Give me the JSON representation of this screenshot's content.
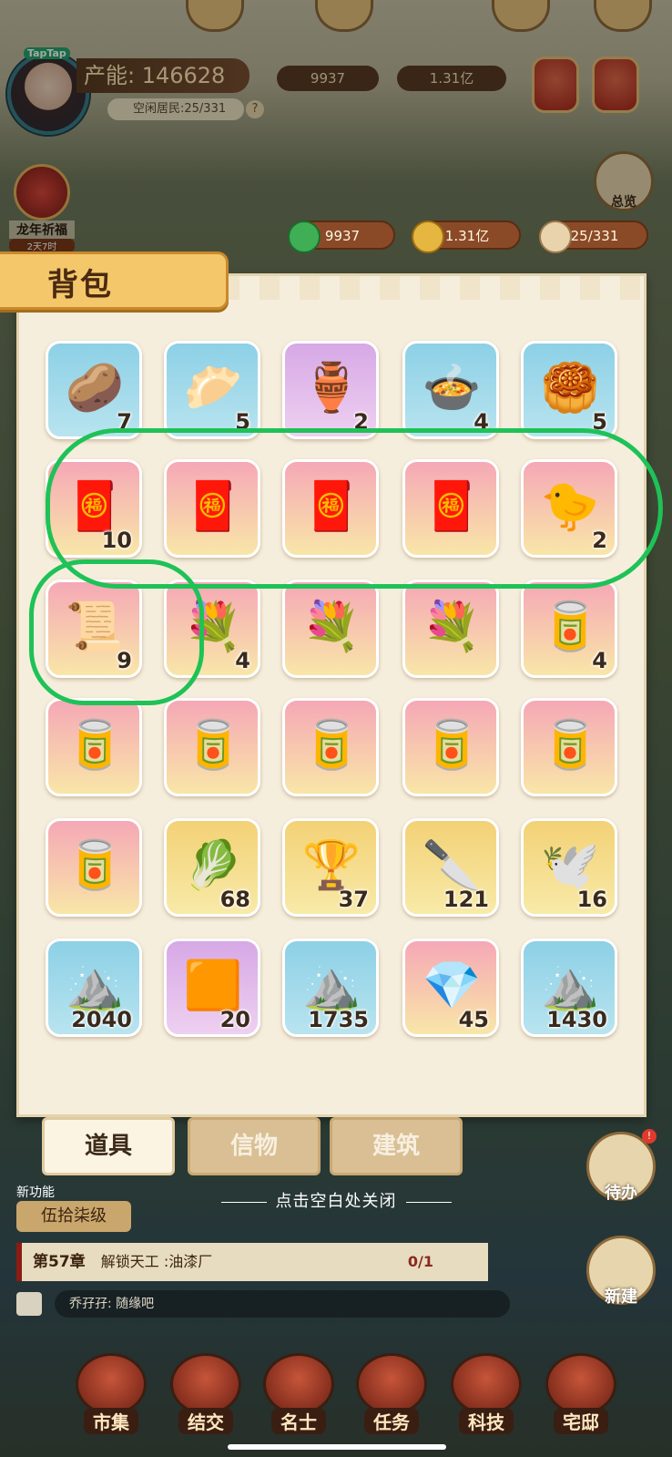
{
  "hud": {
    "power": "产能: 146628",
    "idle_residents": "空闲居民:25/331",
    "help": "?",
    "top_currency_1": "9937",
    "top_currency_2": "1.31亿",
    "overview_label": "总览",
    "festival_title": "龙年祈福",
    "festival_countdown": "2天7时",
    "taptap": "TapTap"
  },
  "resources": [
    {
      "icon": "jade-coin-icon",
      "value": "9937"
    },
    {
      "icon": "gold-coin-icon",
      "value": "1.31亿"
    },
    {
      "icon": "residents-icon",
      "value": "25/331"
    }
  ],
  "panel": {
    "title": "背包"
  },
  "items": [
    {
      "icon": "🥔",
      "name": "ginger-root",
      "bg": "blue",
      "count": "7"
    },
    {
      "icon": "🥟",
      "name": "steamed-buns",
      "bg": "blue",
      "count": "5"
    },
    {
      "icon": "🏺",
      "name": "plum-vase",
      "bg": "purple",
      "count": "2"
    },
    {
      "icon": "🍲",
      "name": "rice-bowl",
      "bg": "blue",
      "count": "4"
    },
    {
      "icon": "🥮",
      "name": "steamer-basket",
      "bg": "blue",
      "count": "5"
    },
    {
      "icon": "🧧",
      "name": "red-envelope",
      "bg": "pink",
      "count": "10"
    },
    {
      "icon": "🧧",
      "name": "red-envelope",
      "bg": "pink",
      "count": ""
    },
    {
      "icon": "🧧",
      "name": "red-envelope",
      "bg": "pink",
      "count": ""
    },
    {
      "icon": "🧧",
      "name": "red-envelope",
      "bg": "pink",
      "count": ""
    },
    {
      "icon": "🐤",
      "name": "rubber-duck",
      "bg": "pink",
      "count": "2"
    },
    {
      "icon": "📜",
      "name": "paper-scroll",
      "bg": "pink",
      "count": "9"
    },
    {
      "icon": "💐",
      "name": "flower-vase",
      "bg": "pink",
      "count": "4"
    },
    {
      "icon": "💐",
      "name": "flower-vase",
      "bg": "pink",
      "count": ""
    },
    {
      "icon": "💐",
      "name": "flower-vase",
      "bg": "pink",
      "count": ""
    },
    {
      "icon": "🥫",
      "name": "fish-can",
      "bg": "pink",
      "count": "4"
    },
    {
      "icon": "🥫",
      "name": "fish-can",
      "bg": "pink",
      "count": ""
    },
    {
      "icon": "🥫",
      "name": "fish-can",
      "bg": "pink",
      "count": ""
    },
    {
      "icon": "🥫",
      "name": "fish-can",
      "bg": "pink",
      "count": ""
    },
    {
      "icon": "🥫",
      "name": "fish-can",
      "bg": "pink",
      "count": ""
    },
    {
      "icon": "🥫",
      "name": "fish-can",
      "bg": "pink",
      "count": ""
    },
    {
      "icon": "🥫",
      "name": "fish-can",
      "bg": "pink",
      "count": ""
    },
    {
      "icon": "🥬",
      "name": "turnip",
      "bg": "yellow",
      "count": "68"
    },
    {
      "icon": "🏆",
      "name": "palace-cup",
      "bg": "yellow",
      "count": "37"
    },
    {
      "icon": "🔪",
      "name": "razor-blade",
      "bg": "yellow",
      "count": "121"
    },
    {
      "icon": "🕊️",
      "name": "wreath-dove",
      "bg": "yellow",
      "count": "16"
    },
    {
      "icon": "⛰️",
      "name": "gold-sand",
      "bg": "blue",
      "count": "2040"
    },
    {
      "icon": "🟧",
      "name": "amber-ore",
      "bg": "purple",
      "count": "20"
    },
    {
      "icon": "⛰️",
      "name": "pink-sand",
      "bg": "blue",
      "count": "1735"
    },
    {
      "icon": "💎",
      "name": "ruby-ore",
      "bg": "pink",
      "count": "45"
    },
    {
      "icon": "⛰️",
      "name": "gray-sand",
      "bg": "blue",
      "count": "1430"
    }
  ],
  "tabs": [
    {
      "label": "道具",
      "active": true
    },
    {
      "label": "信物",
      "active": false
    },
    {
      "label": "建筑",
      "active": false
    }
  ],
  "close_hint": "点击空白处关闭",
  "lower": {
    "new_feature": "新功能",
    "level": "伍拾柒级",
    "chapter": "第57章",
    "chapter_task": "解锁天工 :油漆厂",
    "chapter_progress": "0/1",
    "chat_text": "乔孖孖: 随缘吧",
    "todo_label": "待办",
    "todo_badge": "!",
    "build_label": "新建"
  },
  "nav": [
    {
      "label": "市集",
      "icon": "market-icon"
    },
    {
      "label": "结交",
      "icon": "cards-icon"
    },
    {
      "label": "名士",
      "icon": "scholar-icon"
    },
    {
      "label": "任务",
      "icon": "task-icon"
    },
    {
      "label": "科技",
      "icon": "tech-icon"
    },
    {
      "label": "宅邸",
      "icon": "mansion-icon"
    }
  ],
  "colors": {
    "ring": "#1ec257",
    "panel": "#f6eedd",
    "title_tab": "#f4c76a"
  }
}
